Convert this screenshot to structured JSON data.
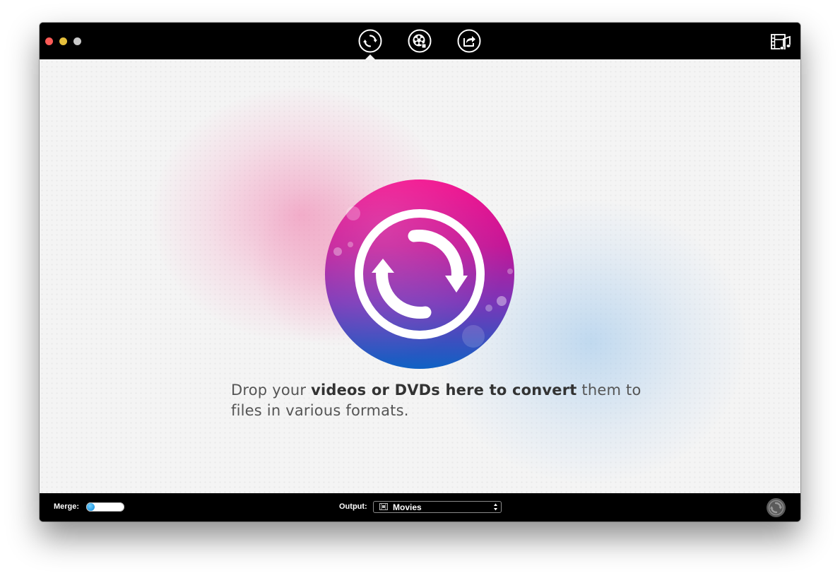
{
  "toolbar": {
    "buttons": [
      {
        "name": "convert-tab",
        "icon": "convert-icon"
      },
      {
        "name": "burn-tab",
        "icon": "film-reel-icon"
      },
      {
        "name": "share-tab",
        "icon": "share-icon"
      }
    ],
    "right_icon": "film-music-icon"
  },
  "main": {
    "drop_text_before": "Drop your ",
    "drop_text_bold": "videos or DVDs here to convert",
    "drop_text_after": " them to files in various formats."
  },
  "bottom": {
    "merge_label": "Merge:",
    "output_label": "Output:",
    "output_value": "Movies"
  },
  "colors": {
    "accent_pink": "#ec0f8c",
    "accent_blue": "#1e60c6",
    "toggle_blue": "#0a86d8"
  }
}
